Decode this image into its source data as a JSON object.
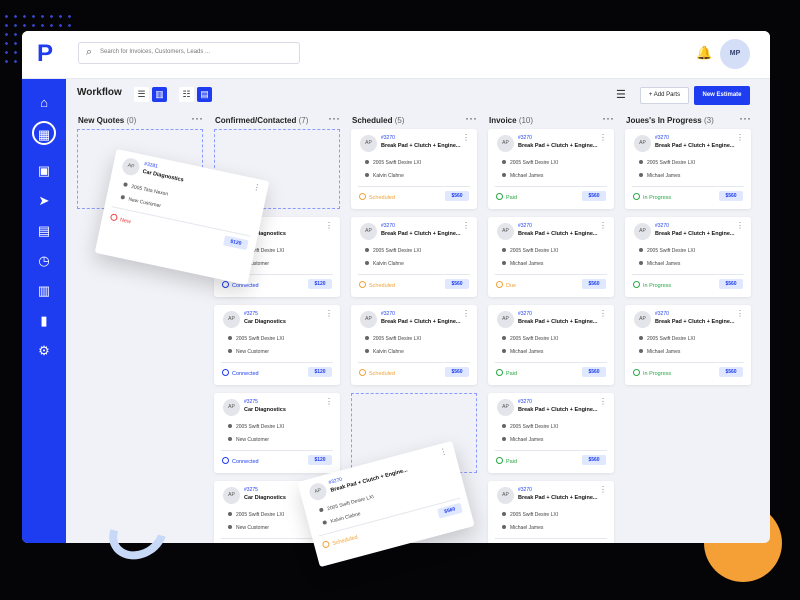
{
  "search": {
    "placeholder": "Search for Invoices, Customers, Leads ..."
  },
  "header": {
    "avatar_initials": "MP"
  },
  "toolbar": {
    "title": "Workflow",
    "add_parts_label": "+ Add Parts",
    "new_estimate_label": "New Estimate"
  },
  "sidebar": {
    "logo": "P"
  },
  "icons": {
    "sidebar": [
      "home-icon",
      "grid-icon",
      "calendar-icon",
      "send-icon",
      "table-icon",
      "clock-icon",
      "document-icon",
      "bar-chart-icon",
      "settings-icon"
    ]
  },
  "colors": {
    "primary": "#1f3df0",
    "connected": "#1f3df0",
    "scheduled": "#f0a33a",
    "paid": "#28a745",
    "due": "#f0a33a",
    "in_progress": "#28a745",
    "new": "#ef4444"
  },
  "columns": [
    {
      "title": "New Quotes",
      "count": "(0)",
      "cards": []
    },
    {
      "title": "Confirmed/Contacted",
      "count": "(7)",
      "cards": [
        {
          "avatar": "AP",
          "id": "#3275",
          "title": "Car Diagnostics",
          "vehicle": "2005 Swift Desire LXI",
          "customer": "New Customer",
          "status": "Connected",
          "price": "$120"
        },
        {
          "avatar": "AP",
          "id": "#3275",
          "title": "Car Diagnostics",
          "vehicle": "2005 Swift Desire LXI",
          "customer": "New Customer",
          "status": "Connected",
          "price": "$120"
        },
        {
          "avatar": "AP",
          "id": "#3275",
          "title": "Car Diagnostics",
          "vehicle": "2005 Swift Desire LXI",
          "customer": "New Customer",
          "status": "Connected",
          "price": "$120"
        },
        {
          "avatar": "AP",
          "id": "#3275",
          "title": "Car Diagnostics",
          "vehicle": "2005 Swift Desire LXI",
          "customer": "New Customer",
          "status": "Connected",
          "price": "$120"
        }
      ]
    },
    {
      "title": "Scheduled",
      "count": "(5)",
      "cards": [
        {
          "avatar": "AP",
          "id": "#3270",
          "title": "Break Pad + Clutch + Engine...",
          "vehicle": "2005 Swift Desire LXI",
          "customer": "Kalvin Clahne",
          "status": "Scheduled",
          "price": "$560"
        },
        {
          "avatar": "AP",
          "id": "#3270",
          "title": "Break Pad + Clutch + Engine...",
          "vehicle": "2005 Swift Desire LXI",
          "customer": "Kalvin Clahne",
          "status": "Scheduled",
          "price": "$560"
        },
        {
          "avatar": "AP",
          "id": "#3270",
          "title": "Break Pad + Clutch + Engine...",
          "vehicle": "2005 Swift Desire LXI",
          "customer": "Kalvin Clahne",
          "status": "Scheduled",
          "price": "$560"
        }
      ]
    },
    {
      "title": "Invoice",
      "count": "(10)",
      "cards": [
        {
          "avatar": "AP",
          "id": "#3270",
          "title": "Break Pad + Clutch + Engine...",
          "vehicle": "2005 Swift Desire LXI",
          "customer": "Michael James",
          "status": "Paid",
          "price": "$560"
        },
        {
          "avatar": "AP",
          "id": "#3270",
          "title": "Break Pad + Clutch + Engine...",
          "vehicle": "2005 Swift Desire LXI",
          "customer": "Michael James",
          "status": "Due",
          "price": "$560"
        },
        {
          "avatar": "AP",
          "id": "#3270",
          "title": "Break Pad + Clutch + Engine...",
          "vehicle": "2005 Swift Desire LXI",
          "customer": "Michael James",
          "status": "Paid",
          "price": "$560"
        },
        {
          "avatar": "AP",
          "id": "#3270",
          "title": "Break Pad + Clutch + Engine...",
          "vehicle": "2005 Swift Desire LXI",
          "customer": "Michael James",
          "status": "Paid",
          "price": "$560"
        },
        {
          "avatar": "AP",
          "id": "#3270",
          "title": "Break Pad + Clutch + Engine...",
          "vehicle": "2005 Swift Desire LXI",
          "customer": "Michael James",
          "status": "",
          "price": ""
        }
      ]
    },
    {
      "title": "Joues's In Progress",
      "count": "(3)",
      "cards": [
        {
          "avatar": "AP",
          "id": "#3270",
          "title": "Break Pad + Clutch + Engine...",
          "vehicle": "2005 Swift Desire LXI",
          "customer": "Michael James",
          "status": "In Progress",
          "price": "$560"
        },
        {
          "avatar": "AP",
          "id": "#3270",
          "title": "Break Pad + Clutch + Engine...",
          "vehicle": "2005 Swift Desire LXI",
          "customer": "Michael James",
          "status": "In Progress",
          "price": "$560"
        },
        {
          "avatar": "AP",
          "id": "#3270",
          "title": "Break Pad + Clutch + Engine...",
          "vehicle": "2005 Swift Desire LXI",
          "customer": "Michael James",
          "status": "In Progress",
          "price": "$560"
        }
      ]
    }
  ],
  "floating_cards": [
    {
      "avatar": "AP",
      "id": "#3281",
      "title": "Car Diagnostics",
      "vehicle": "2005 Tata Nexon",
      "customer": "New Customer",
      "status": "New",
      "price": "$120"
    },
    {
      "avatar": "AP",
      "id": "#3270",
      "title": "Break Pad + Clutch + Engine...",
      "vehicle": "2005 Swift Desire LXI",
      "customer": "Kalvin Clahne",
      "status": "Scheduled",
      "price": "$560"
    }
  ]
}
